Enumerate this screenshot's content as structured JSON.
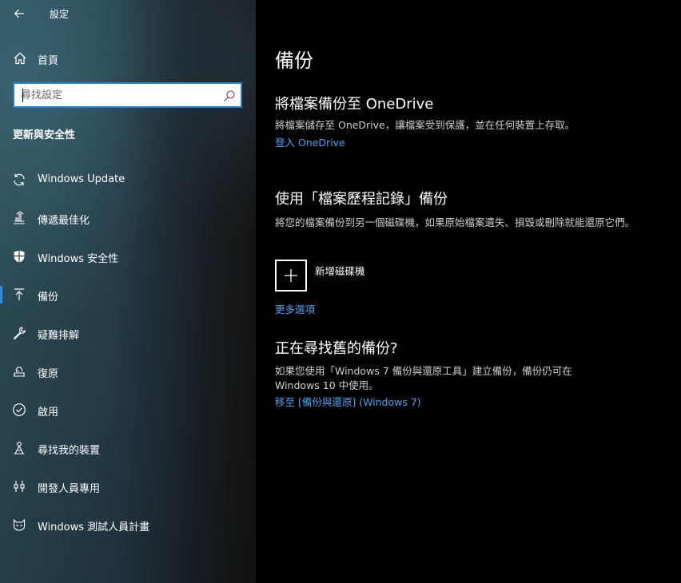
{
  "app": {
    "title": "設定",
    "back_label": "←"
  },
  "sidebar": {
    "home_label": "首頁",
    "search_placeholder": "尋找設定",
    "section_title": "更新與安全性",
    "items": [
      {
        "label": "Windows Update",
        "icon": "sync-icon"
      },
      {
        "label": "傳遞最佳化",
        "icon": "delivery-optimization-icon"
      },
      {
        "label": "Windows 安全性",
        "icon": "shield-icon"
      },
      {
        "label": "備份",
        "icon": "backup-arrow-icon",
        "active": true
      },
      {
        "label": "疑難排解",
        "icon": "wrench-icon"
      },
      {
        "label": "復原",
        "icon": "recovery-icon"
      },
      {
        "label": "啟用",
        "icon": "activation-check-icon"
      },
      {
        "label": "尋找我的裝置",
        "icon": "find-device-icon"
      },
      {
        "label": "開發人員專用",
        "icon": "developer-icon"
      },
      {
        "label": "Windows 測試人員計畫",
        "icon": "insider-cat-icon"
      }
    ]
  },
  "main": {
    "title": "備份",
    "onedrive": {
      "heading": "將檔案備份至 OneDrive",
      "description": "將檔案儲存至 OneDrive，讓檔案受到保護，並在任何裝置上存取。",
      "link": "登入 OneDrive"
    },
    "file_history": {
      "heading": "使用「檔案歷程記錄」備份",
      "description": "將您的檔案備份到另一個磁碟機，如果原始檔案遺失、損毀或刪除就能還原它們。",
      "add_drive_label": "新增磁碟機",
      "more_options_link": "更多選項"
    },
    "old_backup": {
      "heading": "正在尋找舊的備份?",
      "description": "如果您使用「Windows 7 備份與還原工具」建立備份，備份仍可在 Windows 10 中使用。",
      "link": "移至 [備份與還原] (Windows 7)"
    }
  },
  "colors": {
    "accent": "#2b8bea",
    "link": "#4aa3f0",
    "main_bg": "#000000"
  }
}
